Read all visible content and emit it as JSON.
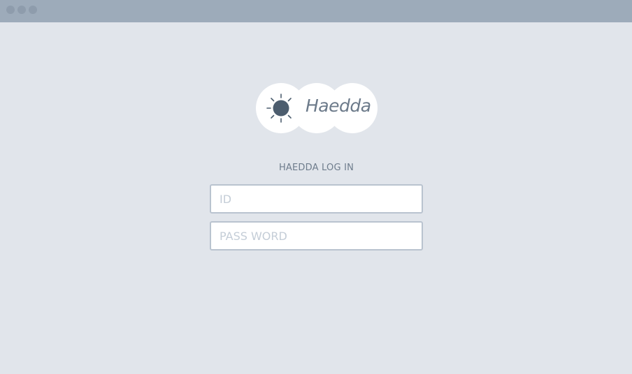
{
  "window": {
    "controls": [
      "close",
      "minimize",
      "maximize"
    ]
  },
  "logo": {
    "icon": "sun-icon",
    "brand": "Haedda"
  },
  "login": {
    "title": "HAEDDA LOG IN",
    "id_placeholder": "ID",
    "id_value": "",
    "password_placeholder": "PASS WORD",
    "password_value": ""
  },
  "colors": {
    "background": "#e1e5eb",
    "titlebar": "#9dabba",
    "accent": "#4c5d6e",
    "text": "#6e7c8c",
    "field_border": "#b9c3cf",
    "placeholder": "#c4cdd7"
  }
}
